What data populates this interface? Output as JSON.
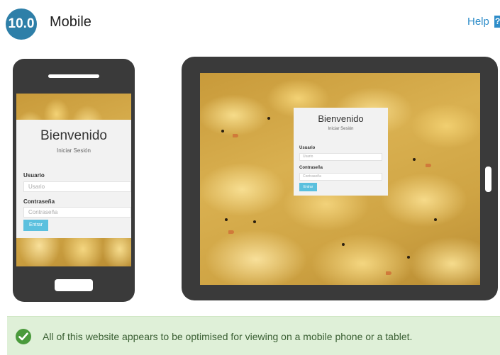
{
  "header": {
    "section_number": "10.0",
    "title": "Mobile",
    "help_label": "Help",
    "help_icon": "?"
  },
  "login_form": {
    "title": "Bienvenido",
    "subtitle": "Iniciar Sesión",
    "username_label": "Usuario",
    "username_placeholder": "Usario",
    "password_label": "Contraseña",
    "password_placeholder": "Contraseña",
    "submit_label": "Entrar"
  },
  "result": {
    "status": "pass",
    "message": "All of this website appears to be optimised for viewing on a mobile phone or a tablet."
  },
  "colors": {
    "badge": "#2e7fa8",
    "link": "#2e8dc9",
    "device_frame": "#3a3a3a",
    "button": "#5bc0de",
    "success_bg": "#dff0d8",
    "success_icon": "#4a9a3c"
  }
}
